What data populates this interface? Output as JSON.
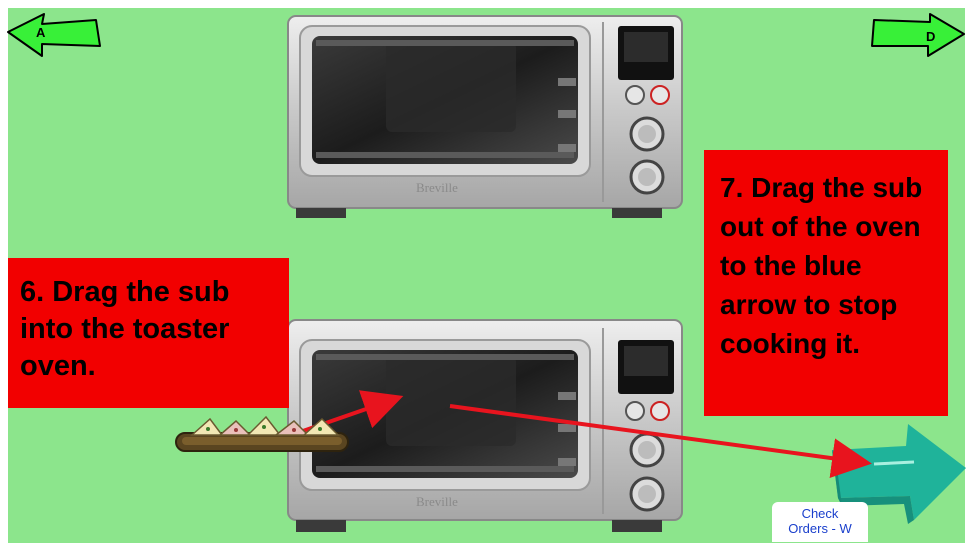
{
  "nav": {
    "prev_label": "A",
    "next_label": "D"
  },
  "ovens": {
    "brand": "Breville"
  },
  "instructions": {
    "step6": "6. Drag the sub into the toaster oven.",
    "step7": "7. Drag the sub out of the oven to the blue arrow to stop cooking it."
  },
  "check_orders": {
    "line1": "Check",
    "line2": "Orders - W"
  },
  "colors": {
    "background": "#8ce58c",
    "instruction_box": "#f20000",
    "drag_path_arrows": "#e8141e",
    "nav_arrows": "#38f038",
    "stop_arrow": "#1fb39a"
  },
  "icons": [
    "left-arrow-icon",
    "right-arrow-icon",
    "sub-sandwich",
    "stop-cooking-arrow-icon"
  ]
}
